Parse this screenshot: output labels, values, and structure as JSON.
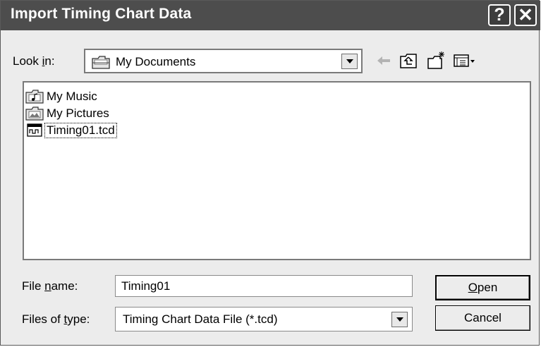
{
  "dialog": {
    "title": "Import Timing Chart Data",
    "help_symbol": "?",
    "close_symbol": "✕"
  },
  "look_in": {
    "label_pre": "Look ",
    "label_access": "i",
    "label_post": "n:",
    "value": "My Documents",
    "icon": "folder-icon"
  },
  "toolbar": {
    "icons": [
      "back-arrow-icon",
      "up-one-level-icon",
      "new-folder-icon",
      "view-menu-icon"
    ]
  },
  "files": [
    {
      "name": "My Music",
      "icon": "music-folder-icon"
    },
    {
      "name": "My Pictures",
      "icon": "pictures-folder-icon"
    },
    {
      "name": "Timing01.tcd",
      "icon": "tcd-file-icon",
      "selected": true
    }
  ],
  "file_name": {
    "label_pre": "File ",
    "label_access": "n",
    "label_post": "ame:",
    "value": "Timing01"
  },
  "file_type": {
    "label_pre": "Files of ",
    "label_access": "t",
    "label_post": "ype:",
    "value": "Timing Chart Data File (*.tcd)"
  },
  "buttons": {
    "open_access": "O",
    "open_rest": "pen",
    "cancel": "Cancel"
  },
  "colors": {
    "titlebar": "#4d4d4d",
    "dialog_bg": "#ececec"
  }
}
